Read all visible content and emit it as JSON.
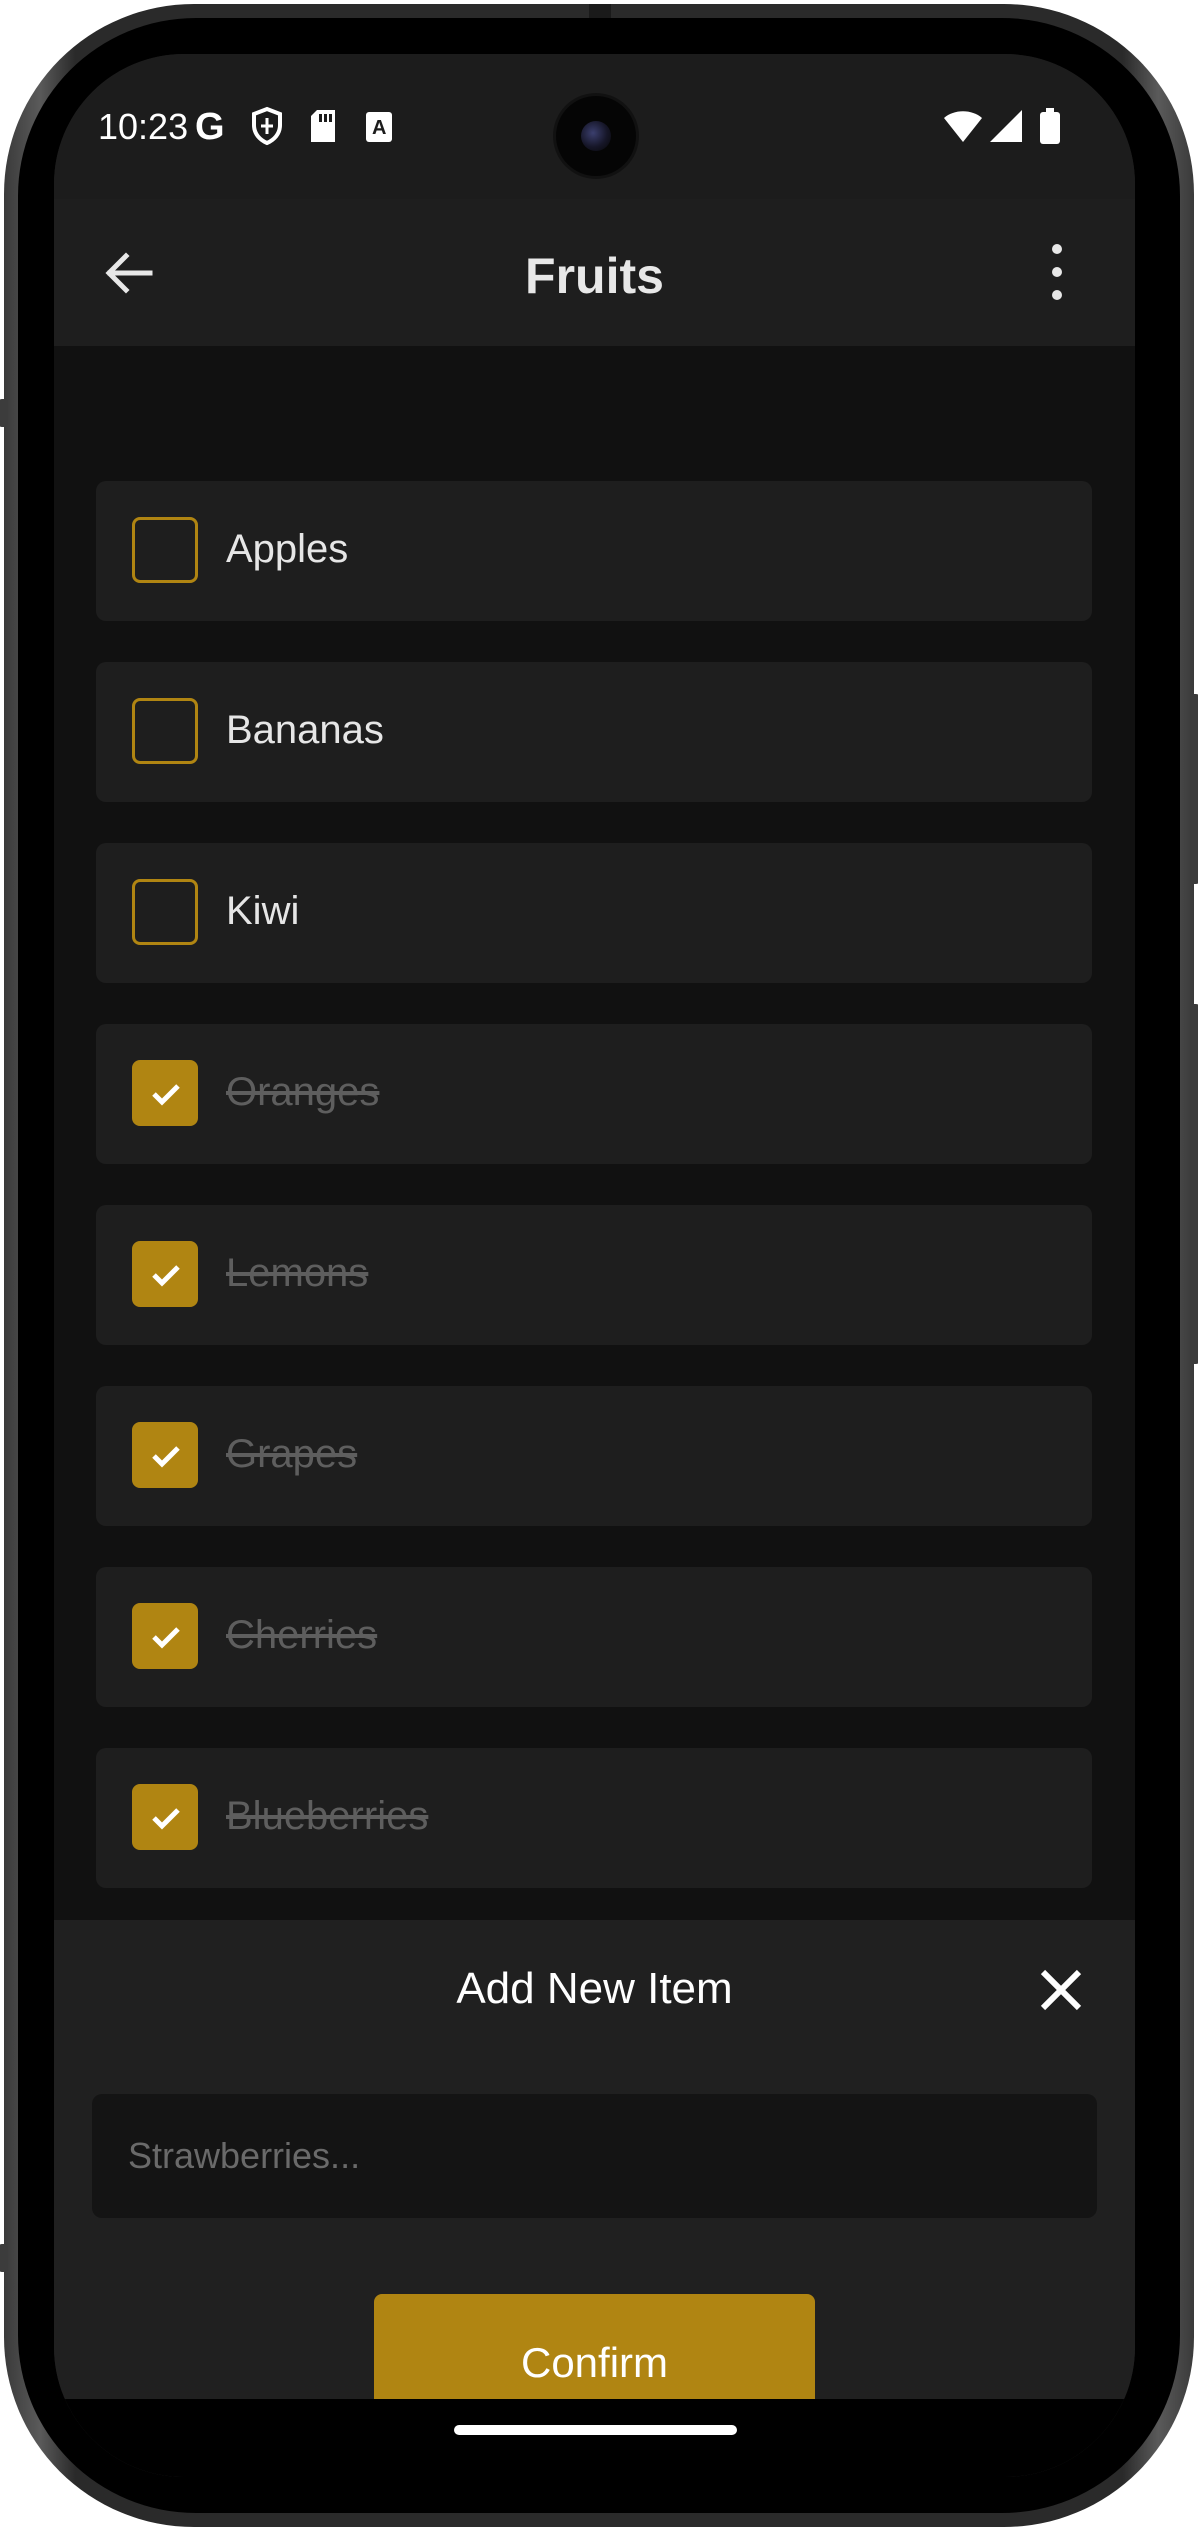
{
  "status_bar": {
    "time": "10:23",
    "left_icons": [
      "google-icon",
      "shield-icon",
      "sd-card-icon",
      "text-a-icon"
    ],
    "right_icons": [
      "wifi-icon",
      "signal-icon",
      "battery-icon"
    ]
  },
  "app_bar": {
    "title": "Fruits",
    "back_icon": "arrow-left-icon",
    "menu_icon": "more-vert-icon"
  },
  "items": [
    {
      "label": "Apples",
      "checked": false
    },
    {
      "label": "Bananas",
      "checked": false
    },
    {
      "label": "Kiwi",
      "checked": false
    },
    {
      "label": "Oranges",
      "checked": true
    },
    {
      "label": "Lemons",
      "checked": true
    },
    {
      "label": "Grapes",
      "checked": true
    },
    {
      "label": "Cherries",
      "checked": true
    },
    {
      "label": "Blueberries",
      "checked": true
    }
  ],
  "sheet": {
    "title": "Add New Item",
    "input_value": "",
    "input_placeholder": "Strawberries...",
    "confirm_label": "Confirm"
  },
  "colors": {
    "accent": "#b08512",
    "background": "#111111",
    "card": "#1e1e1e"
  }
}
